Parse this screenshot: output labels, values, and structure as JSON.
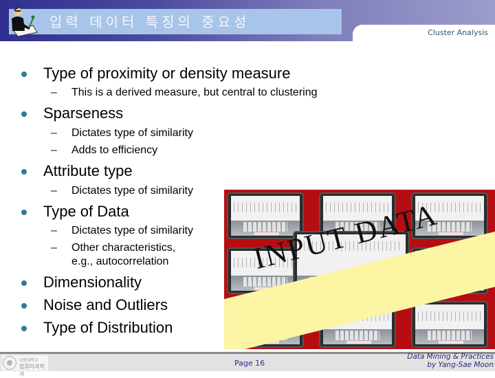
{
  "header": {
    "title": "입력 데이터 특징의 중요성",
    "section": "Cluster Analysis",
    "icon": "person-writing-icon"
  },
  "bullets": [
    {
      "text": "Type of proximity or density measure",
      "sub": [
        "This is a derived measure, but central to clustering"
      ]
    },
    {
      "text": "Sparseness",
      "sub": [
        "Dictates type of similarity",
        "Adds to efficiency"
      ]
    },
    {
      "text": "Attribute type",
      "sub": [
        "Dictates type of similarity"
      ]
    },
    {
      "text": "Type of Data",
      "sub": [
        "Dictates type of similarity",
        "Other characteristics,",
        "e.g., autocorrelation"
      ]
    },
    {
      "text": "Dimensionality",
      "sub": []
    },
    {
      "text": "Noise and Outliers",
      "sub": []
    },
    {
      "text": "Type of Distribution",
      "sub": []
    }
  ],
  "picture": {
    "banner_text": "INPUT DATA",
    "description": "tablets showing spreadsheets with on-screen keyboards on red background"
  },
  "footer": {
    "logo_line1": "강원대학교",
    "logo_line2": "컴퓨터과학과",
    "page": "Page 16",
    "credit_line1": "Data Mining & Practices",
    "credit_line2": "by Yang-Sae Moon"
  },
  "colors": {
    "bullet": "#2e7b9b",
    "header_dark": "#2f2f8f",
    "header_light": "#9c9ccc",
    "title_bar": "#a8c4e8",
    "banner": "#fbf5a4",
    "picture_bg": "#b60d12"
  }
}
